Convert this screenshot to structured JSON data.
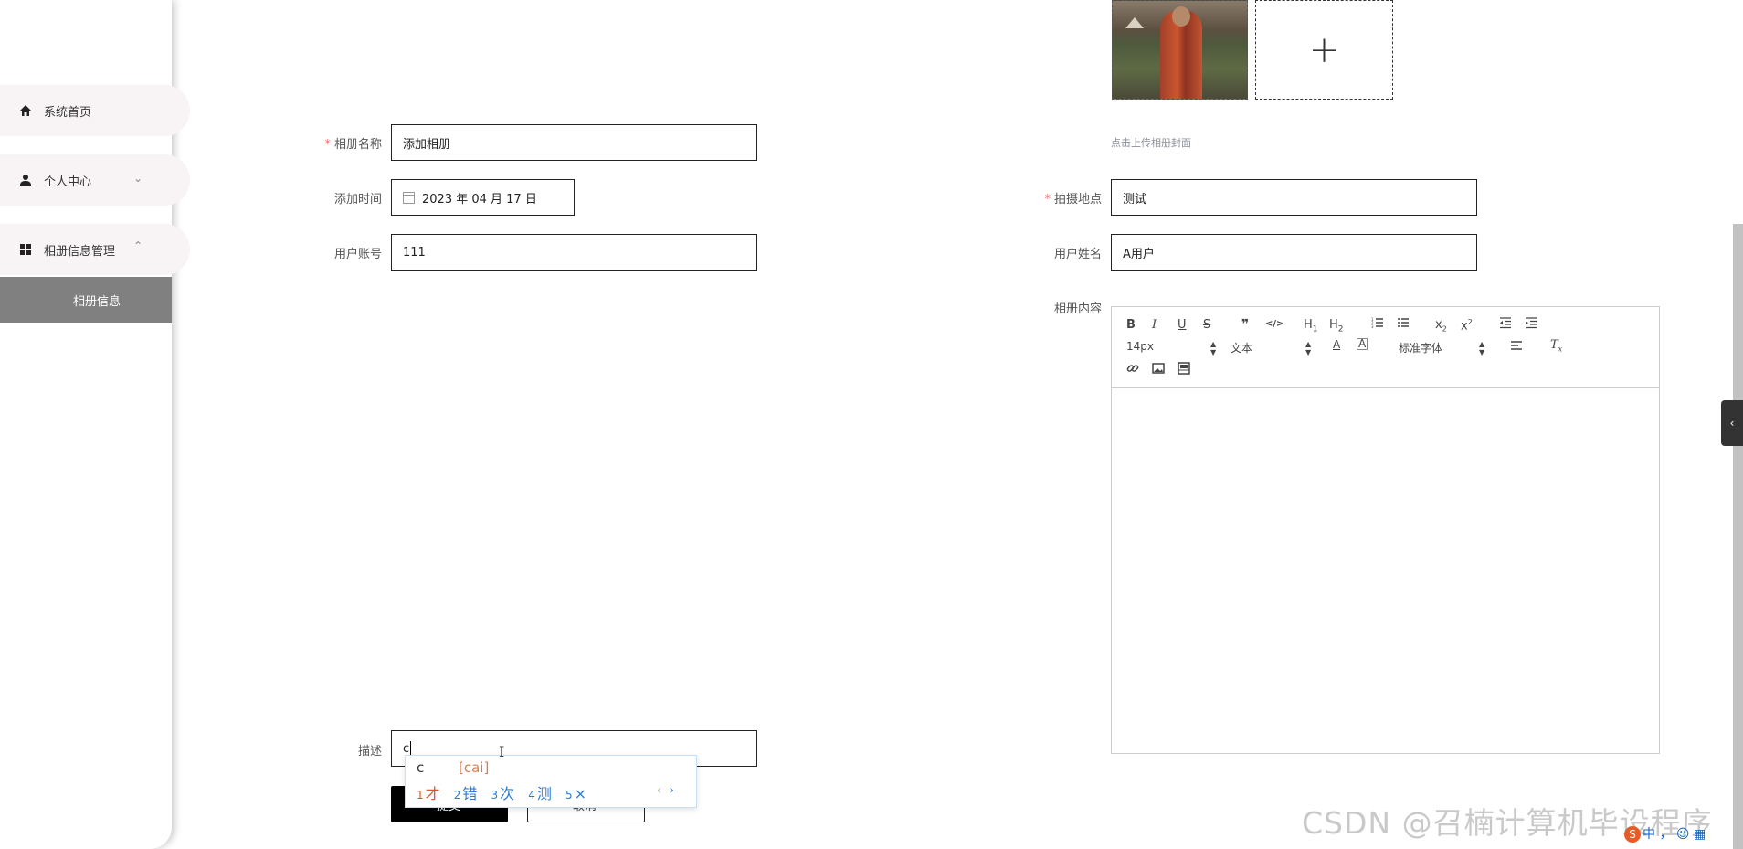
{
  "sidebar": {
    "items": [
      {
        "label": "系统首页",
        "icon": "home-icon"
      },
      {
        "label": "个人中心",
        "icon": "user-icon"
      },
      {
        "label": "相册信息管理",
        "icon": "grid-icon"
      }
    ],
    "submenu_active": "相册信息"
  },
  "form": {
    "album_name": {
      "label": "相册名称",
      "required": true,
      "value": "添加相册"
    },
    "add_time": {
      "label": "添加时间",
      "value": "2023 年 04 月 17 日"
    },
    "user_account": {
      "label": "用户账号",
      "value": "111"
    },
    "description": {
      "label": "描述",
      "value": "c"
    },
    "cover_hint": "点击上传相册封面",
    "upload_plus": "+",
    "location": {
      "label": "拍摄地点",
      "required": true,
      "value": "测试"
    },
    "user_name": {
      "label": "用户姓名",
      "value": "A用户"
    },
    "content": {
      "label": "相册内容"
    }
  },
  "editor": {
    "font_size": "14px",
    "text_type": "文本",
    "font_family": "标准字体",
    "buttons": [
      "B",
      "I",
      "U",
      "S",
      "❞",
      "</>",
      "H1",
      "H2",
      "ordered-list",
      "bullet-list",
      "x₂",
      "x²",
      "outdent",
      "indent",
      "text-color",
      "text-bg",
      "align",
      "clear-format",
      "link",
      "image",
      "video"
    ]
  },
  "buttons": {
    "submit": "提交",
    "cancel": "取消"
  },
  "ime": {
    "composition": "c",
    "pinyin": "[cai]",
    "candidates": [
      {
        "n": "1",
        "text": "才"
      },
      {
        "n": "2",
        "text": "错"
      },
      {
        "n": "3",
        "text": "次"
      },
      {
        "n": "4",
        "text": "测"
      },
      {
        "n": "5",
        "text": "×"
      }
    ],
    "prev": "‹",
    "next": "›"
  },
  "watermark": "CSDN @召楠计算机毕设程序",
  "tray": {
    "lang": "中"
  },
  "colors": {
    "required": "#f56c6c",
    "submenu_bg": "#808080",
    "ime_first": "#e0532a",
    "ime_other": "#2d7ad1"
  }
}
